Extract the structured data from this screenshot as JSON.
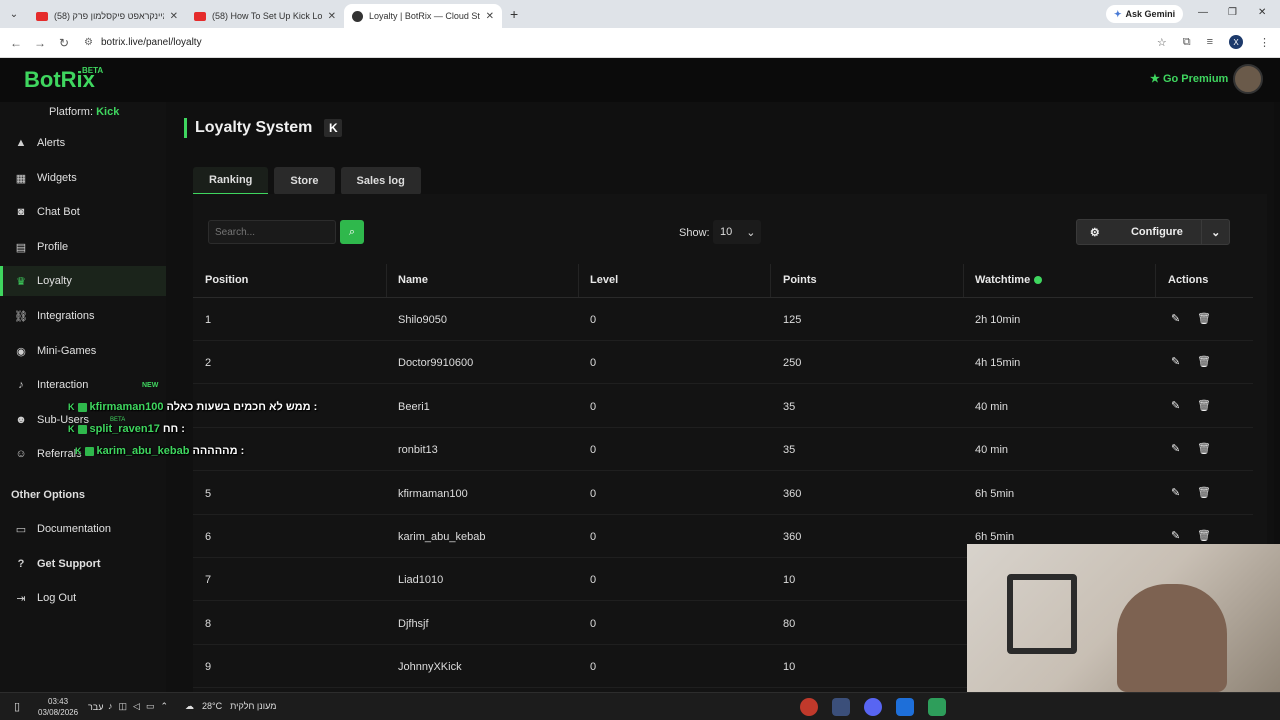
{
  "browser": {
    "tabs": [
      {
        "title": "(58) מיינקראפט פיקסלמון פרק",
        "active": false
      },
      {
        "title": "(58) How To Set Up Kick Loyalty",
        "active": false
      },
      {
        "title": "Loyalty | BotRix — Cloud Stream",
        "active": true
      }
    ],
    "gemini_label": "Ask Gemini",
    "url": "botrix.live/panel/loyalty"
  },
  "header": {
    "logo": "BotRix",
    "logo_badge": "BETA",
    "premium_label": "Go Premium"
  },
  "sidebar": {
    "platform_label": "Platform:",
    "platform_value": "Kick",
    "items": [
      {
        "label": "Alerts",
        "icon": "warning-icon"
      },
      {
        "label": "Widgets",
        "icon": "grid-icon"
      },
      {
        "label": "Chat Bot",
        "icon": "robot-icon"
      },
      {
        "label": "Profile",
        "icon": "id-card-icon"
      },
      {
        "label": "Loyalty",
        "icon": "trophy-icon",
        "active": true
      },
      {
        "label": "Integrations",
        "icon": "link-icon"
      },
      {
        "label": "Mini-Games",
        "icon": "gamepad-icon"
      },
      {
        "label": "Interaction",
        "icon": "microphone-icon",
        "badge": "NEW"
      },
      {
        "label": "Sub-Users",
        "icon": "users-icon",
        "badge": "BETA"
      },
      {
        "label": "Referrals",
        "icon": "user-group-icon"
      }
    ],
    "other_title": "Other Options",
    "other_items": [
      {
        "label": "Documentation",
        "icon": "book-icon"
      },
      {
        "label": "Get Support",
        "icon": "question-icon"
      },
      {
        "label": "Log Out",
        "icon": "logout-icon"
      }
    ]
  },
  "page": {
    "title": "Loyalty System",
    "platform_icon": "K",
    "tabs": [
      "Ranking",
      "Store",
      "Sales log"
    ],
    "search_placeholder": "Search...",
    "show_label": "Show:",
    "show_value": "10",
    "configure_label": "Configure",
    "columns": [
      "Position",
      "Name",
      "Level",
      "Points",
      "Watchtime",
      "Actions"
    ],
    "rows": [
      {
        "position": "1",
        "name": "Shilo9050",
        "level": "0",
        "points": "125",
        "watchtime": "2h 10min"
      },
      {
        "position": "2",
        "name": "Doctor9910600",
        "level": "0",
        "points": "250",
        "watchtime": "4h 15min"
      },
      {
        "position": "",
        "name": "Beeri1",
        "level": "0",
        "points": "35",
        "watchtime": "40 min"
      },
      {
        "position": "",
        "name": "ronbit13",
        "level": "0",
        "points": "35",
        "watchtime": "40 min"
      },
      {
        "position": "5",
        "name": "kfirmaman100",
        "level": "0",
        "points": "360",
        "watchtime": "6h 5min"
      },
      {
        "position": "6",
        "name": "karim_abu_kebab",
        "level": "0",
        "points": "360",
        "watchtime": "6h 5min"
      },
      {
        "position": "7",
        "name": "Liad1010",
        "level": "0",
        "points": "10",
        "watchtime": ""
      },
      {
        "position": "8",
        "name": "Djfhsjf",
        "level": "0",
        "points": "80",
        "watchtime": ""
      },
      {
        "position": "9",
        "name": "JohnnyXKick",
        "level": "0",
        "points": "10",
        "watchtime": ""
      }
    ]
  },
  "chat_overlay": [
    {
      "user": "kfirmaman100",
      "message": "ממש לא חכמים בשעות כאלה :"
    },
    {
      "user": "split_raven17",
      "message": "חח :"
    },
    {
      "user": "karim_abu_kebab",
      "message": "מההההה :"
    }
  ],
  "taskbar": {
    "time": "03:43",
    "date": "03/08/2026",
    "lang": "עבר",
    "temperature": "28°C",
    "weather": "מעונן חלקית"
  },
  "colors": {
    "accent": "#3fd65f",
    "background": "#0e0e0e"
  }
}
